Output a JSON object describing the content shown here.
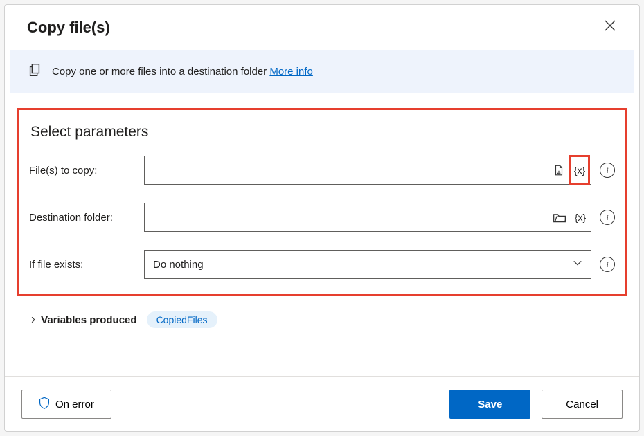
{
  "dialog": {
    "title": "Copy file(s)",
    "banner_text": "Copy one or more files into a destination folder ",
    "more_info": "More info"
  },
  "params": {
    "section_title": "Select parameters",
    "files_label": "File(s) to copy:",
    "files_value": "",
    "dest_label": "Destination folder:",
    "dest_value": "",
    "exists_label": "If file exists:",
    "exists_value": "Do nothing",
    "var_token": "{x}"
  },
  "variables": {
    "label": "Variables produced",
    "produced": "CopiedFiles"
  },
  "footer": {
    "on_error": "On error",
    "save": "Save",
    "cancel": "Cancel"
  }
}
